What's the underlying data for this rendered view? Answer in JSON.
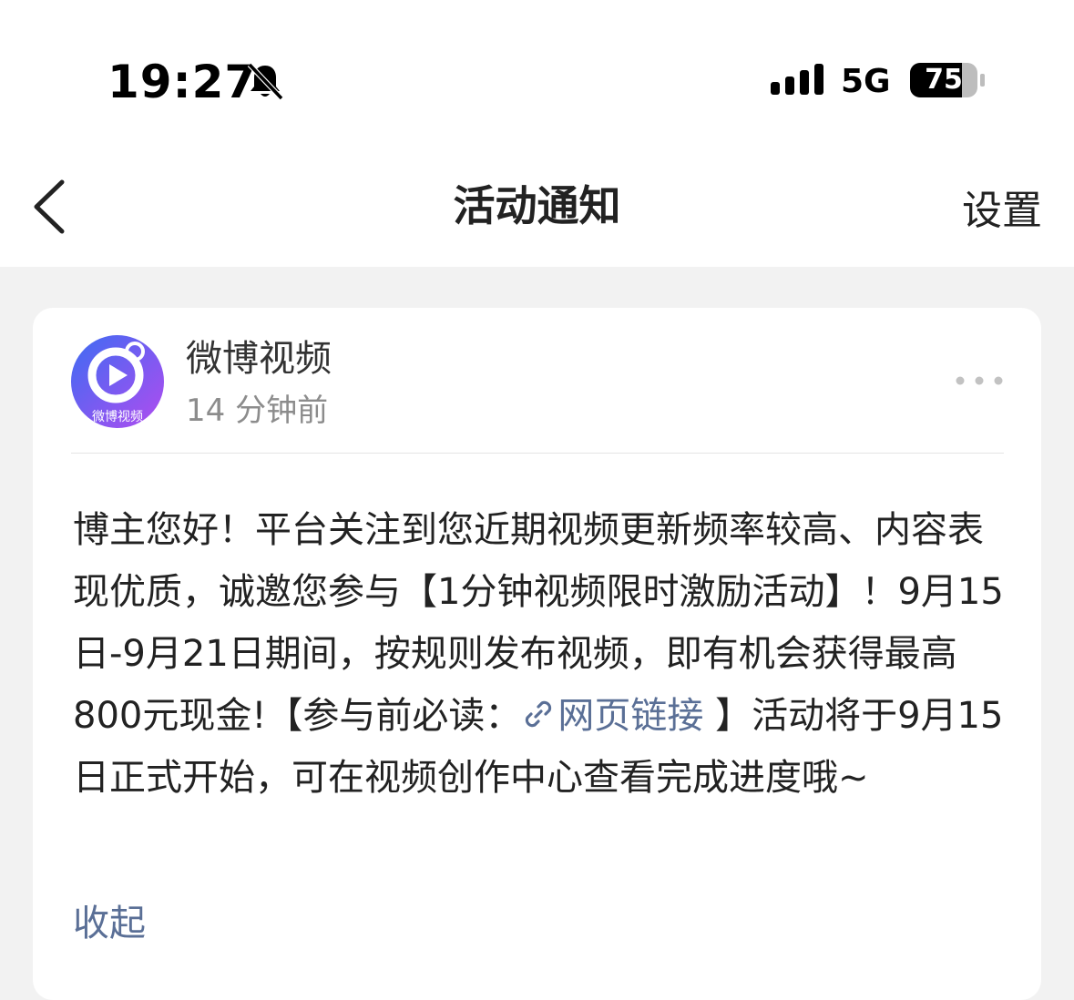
{
  "status_bar": {
    "time": "19:27",
    "network": "5G",
    "battery": "75"
  },
  "nav": {
    "title": "活动通知",
    "settings_label": "设置"
  },
  "card": {
    "avatar_text": "微博视频",
    "sender": "微博视频",
    "time_ago": "14 分钟前",
    "message_part1": "博主您好！平台关注到您近期视频更新频率较高、内容表现优质，诚邀您参与【1分钟视频限时激励活动】！9月15日-9月21日期间，按规则发布视频，即有机会获得最高800元现金!【参与前必读：",
    "link_text": "网页链接",
    "message_part2": " 】活动将于9月15日正式开始，可在视频创作中心查看完成进度哦~",
    "collapse_label": "收起"
  },
  "colors": {
    "link": "#5a6f96",
    "background": "#f2f2f2"
  }
}
